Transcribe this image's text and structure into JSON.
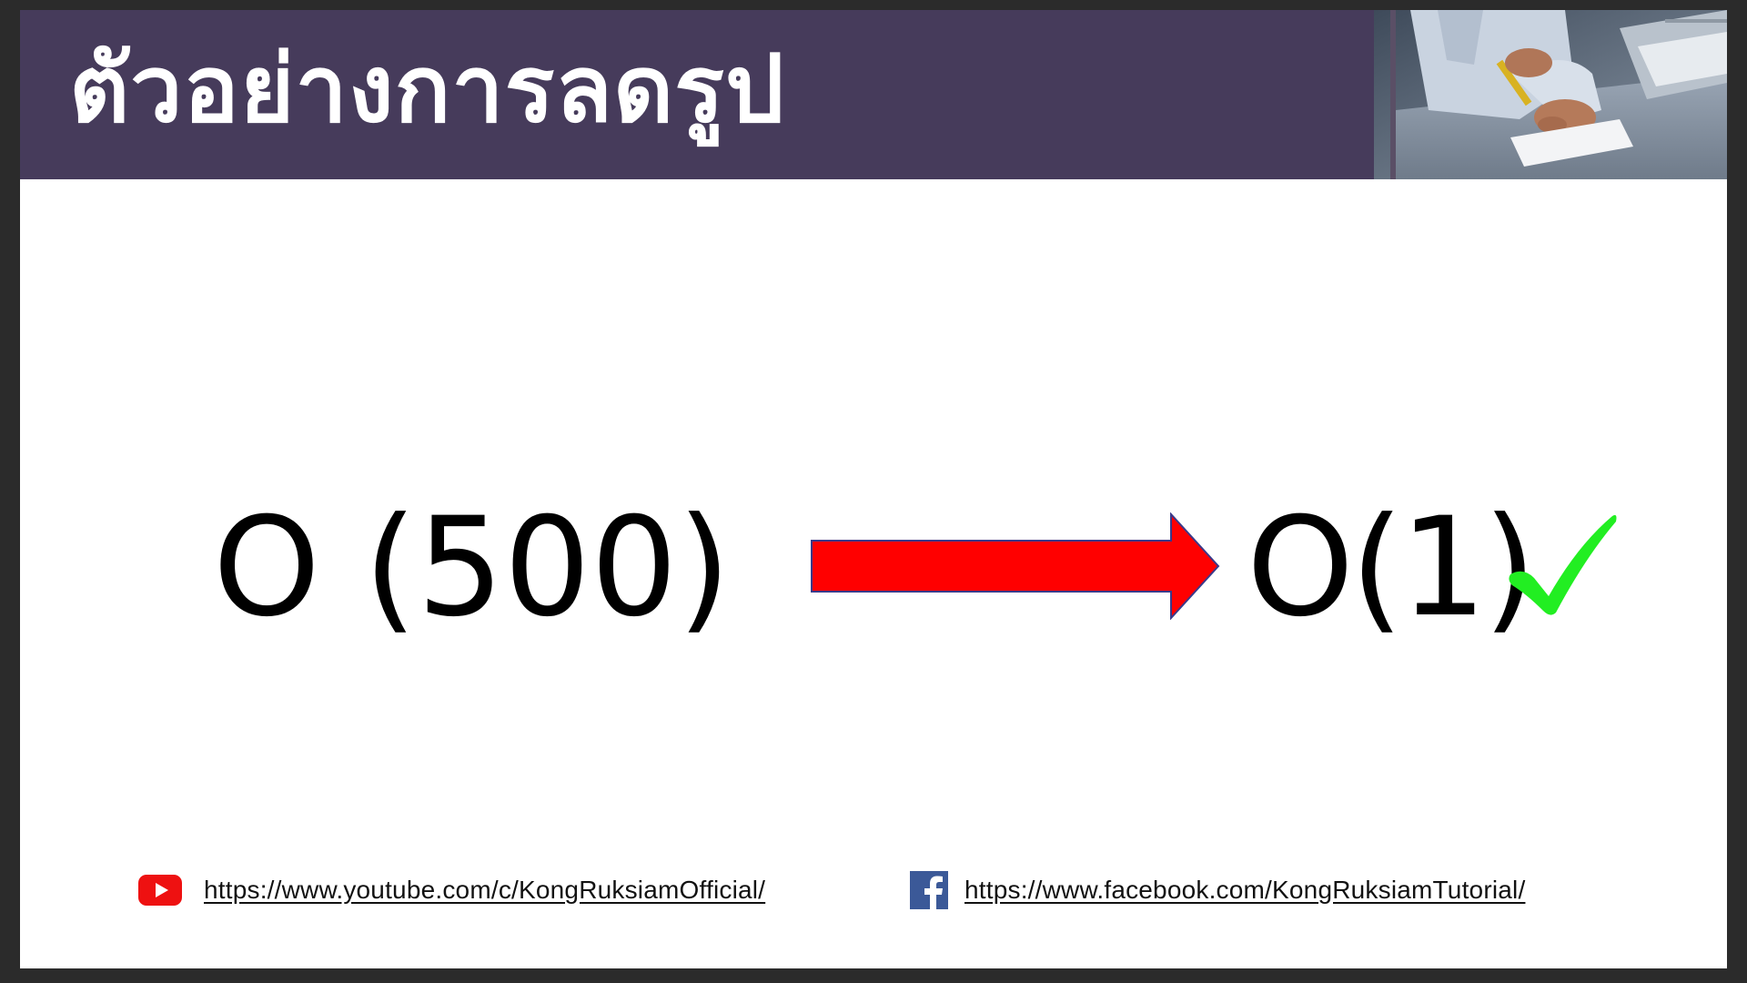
{
  "header": {
    "title": "ตัวอย่างการลดรูป",
    "background_color": "#463b5b",
    "photo": "person-writing-at-desk-photo"
  },
  "main": {
    "left_expression": "O (500)",
    "right_expression": "O(1)",
    "arrow_icon": "right-arrow-icon",
    "arrow_color": "#ff0000",
    "check_icon": "check-mark-icon",
    "check_color": "#22ee22"
  },
  "footer": {
    "youtube": {
      "icon": "youtube-icon",
      "url_text": "https://www.youtube.com/c/KongRuksiamOfficial/"
    },
    "facebook": {
      "icon": "facebook-icon",
      "url_text": "https://www.facebook.com/KongRuksiamTutorial/"
    }
  }
}
